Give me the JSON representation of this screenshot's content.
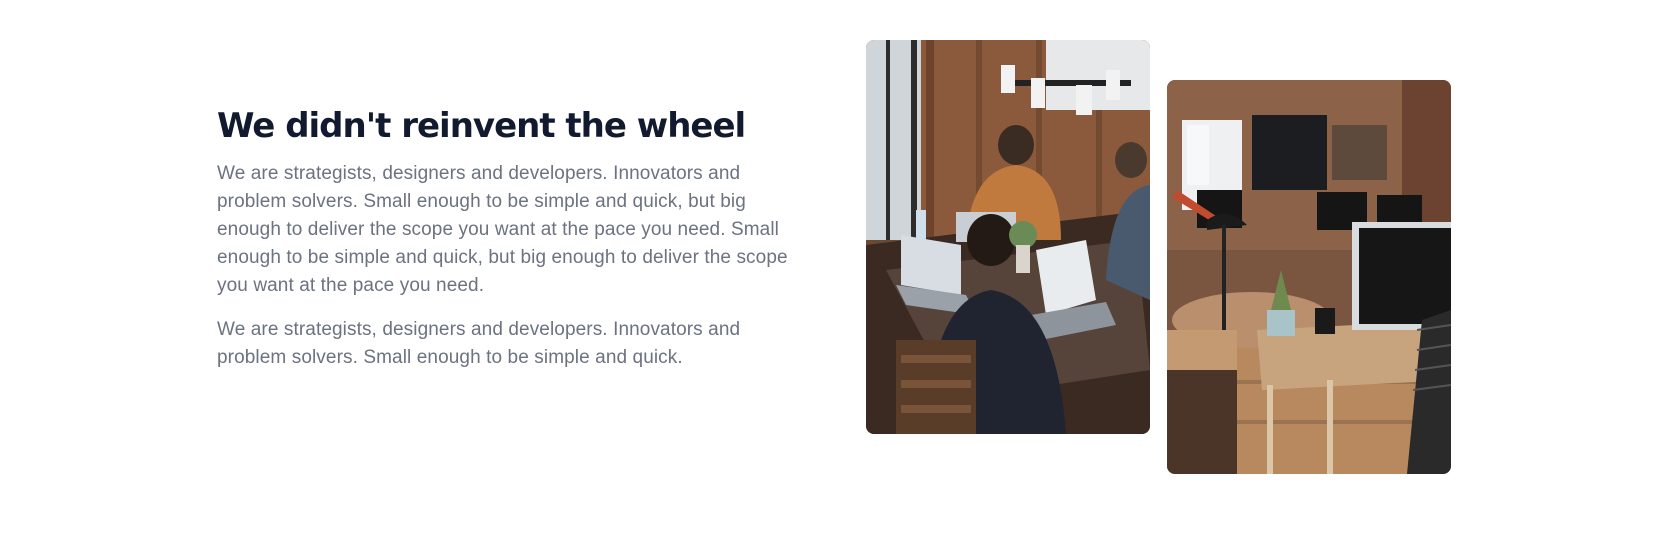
{
  "section": {
    "heading": "We didn't reinvent the wheel",
    "paragraphs": [
      "We are strategists, designers and developers. Innovators and problem solvers. Small enough to be simple and quick, but big enough to deliver the scope you want at the pace you need. Small enough to be simple and quick, but big enough to deliver the scope you want at the pace you need.",
      "We are strategists, designers and developers. Innovators and problem solvers. Small enough to be simple and quick."
    ]
  },
  "images": [
    {
      "name": "team-working-photo"
    },
    {
      "name": "office-workspace-photo"
    }
  ],
  "colors": {
    "heading": "#111a2e",
    "body_text": "#6b7280",
    "background": "#ffffff"
  }
}
